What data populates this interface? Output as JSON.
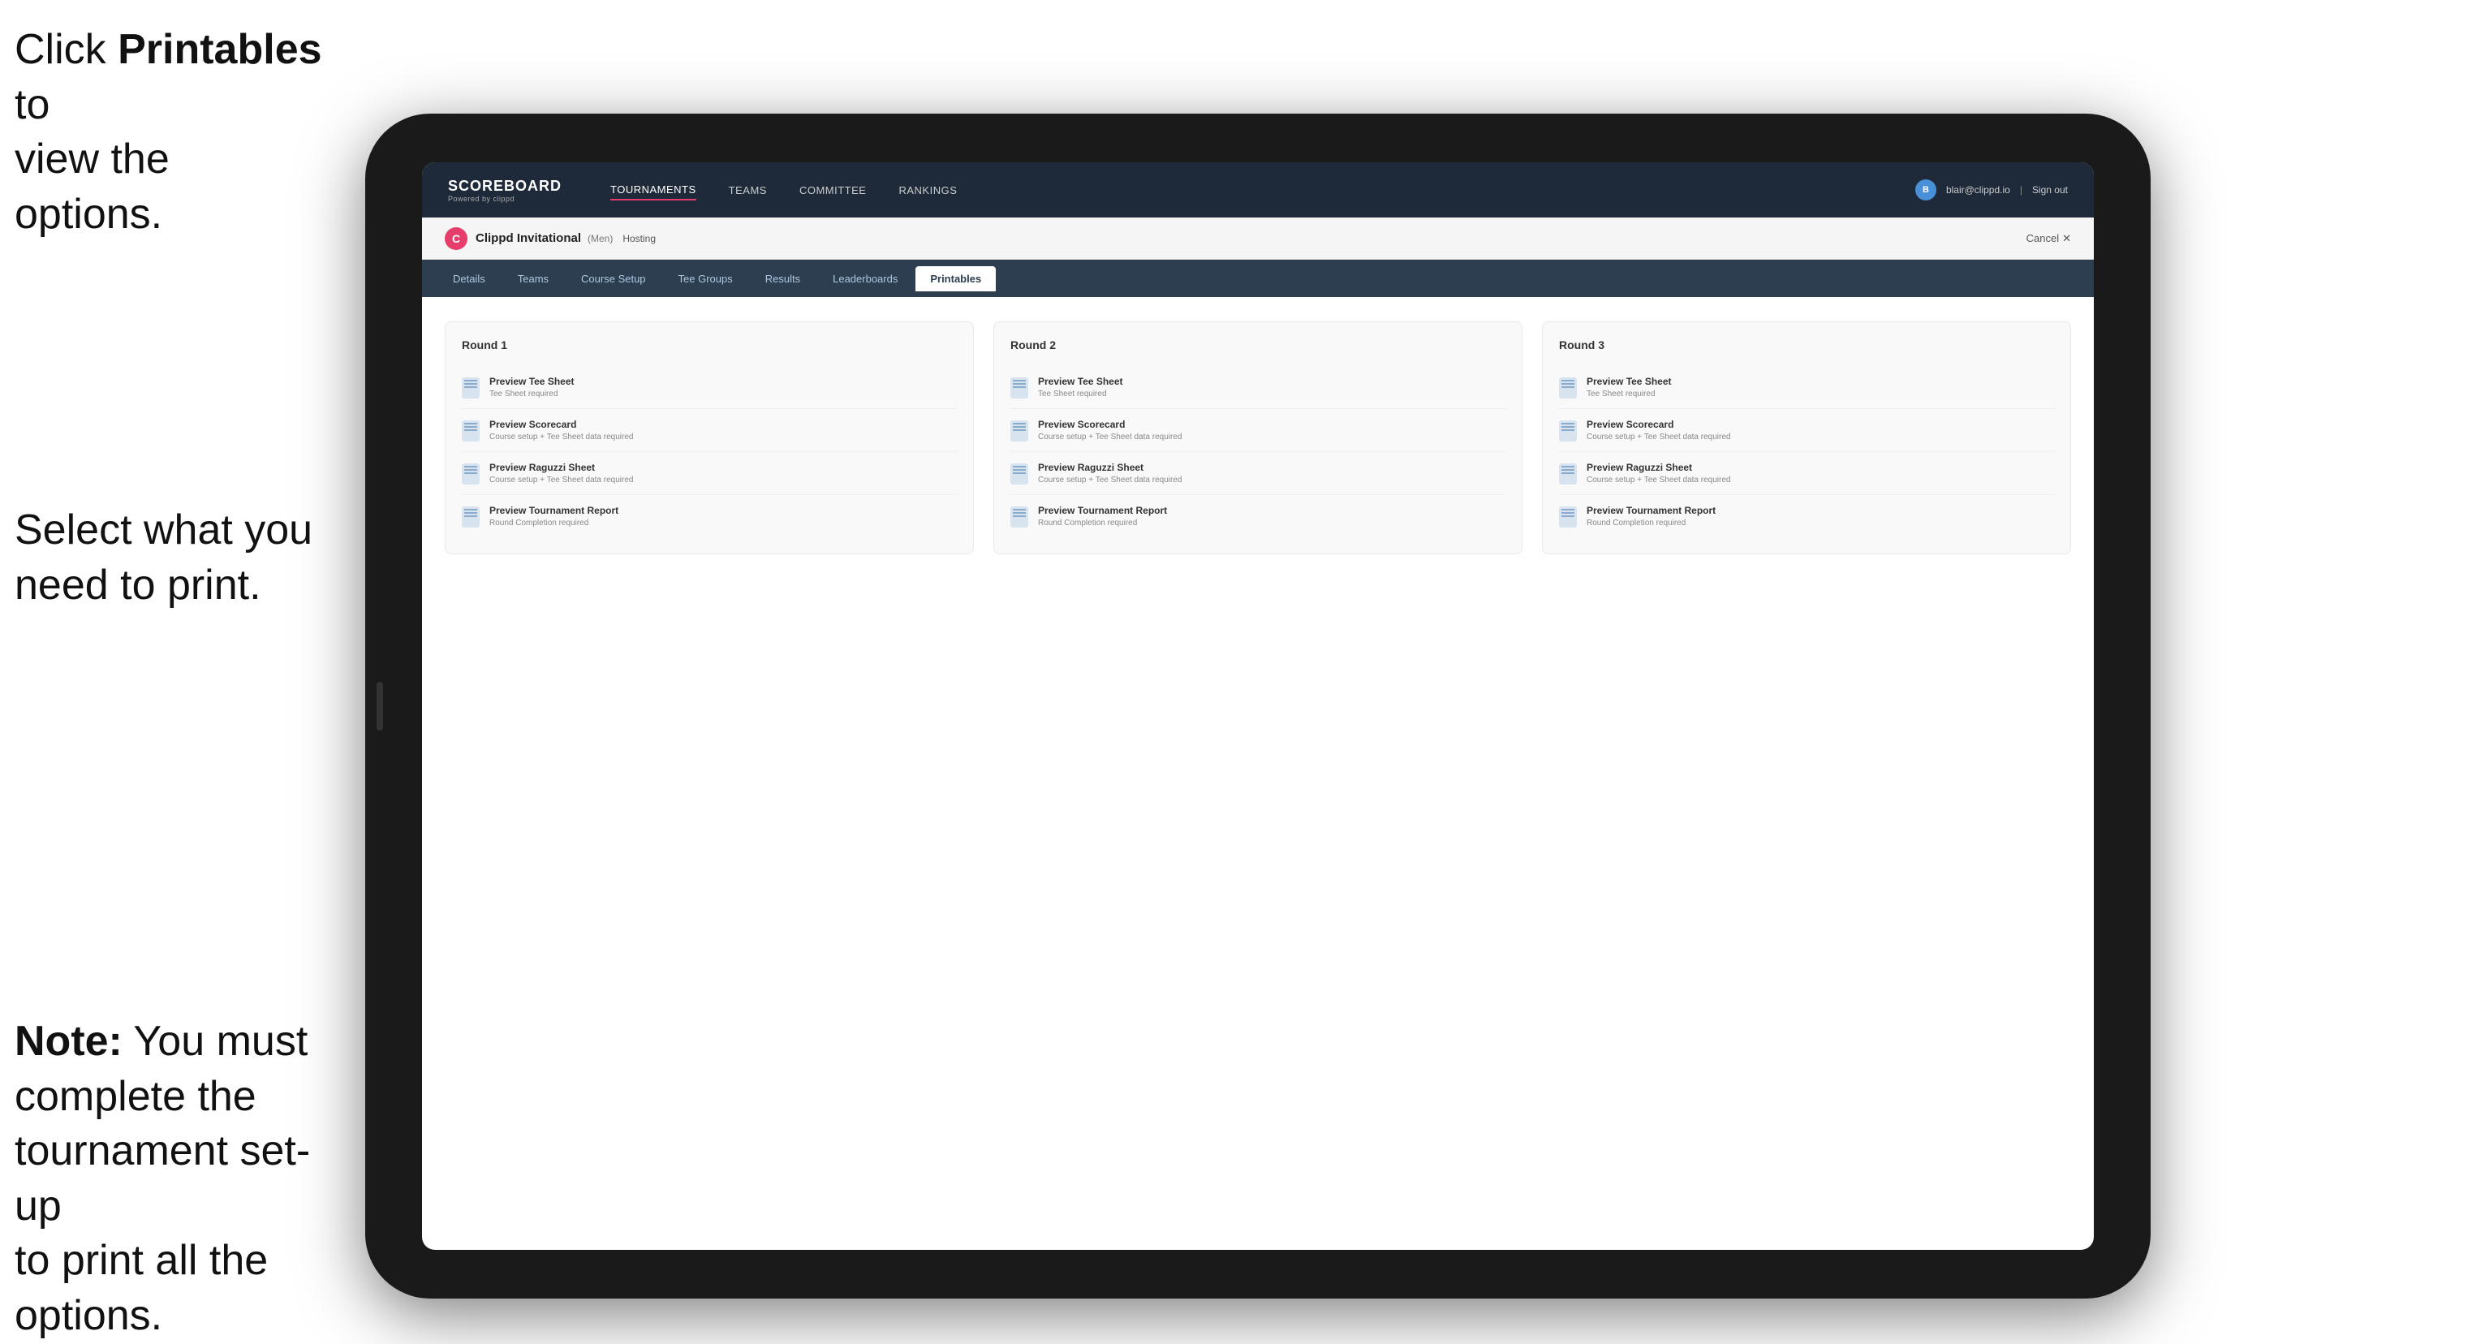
{
  "instructions": {
    "top_line1": "Click ",
    "top_bold": "Printables",
    "top_line2": " to",
    "top_line3": "view the options.",
    "middle_line1": "Select what you",
    "middle_line2": "need to print.",
    "bottom_bold": "Note:",
    "bottom_line1": " You must",
    "bottom_line2": "complete the",
    "bottom_line3": "tournament set-up",
    "bottom_line4": "to print all the options."
  },
  "header": {
    "logo_title": "SCOREBOARD",
    "logo_subtitle": "Powered by clippd",
    "nav": [
      {
        "label": "TOURNAMENTS",
        "active": true
      },
      {
        "label": "TEAMS",
        "active": false
      },
      {
        "label": "COMMITTEE",
        "active": false
      },
      {
        "label": "RANKINGS",
        "active": false
      }
    ],
    "user_email": "blair@clippd.io",
    "sign_out": "Sign out"
  },
  "tournament": {
    "name": "Clippd Invitational",
    "tag": "(Men)",
    "status": "Hosting",
    "cancel": "Cancel"
  },
  "tabs": [
    {
      "label": "Details",
      "active": false
    },
    {
      "label": "Teams",
      "active": false
    },
    {
      "label": "Course Setup",
      "active": false
    },
    {
      "label": "Tee Groups",
      "active": false
    },
    {
      "label": "Results",
      "active": false
    },
    {
      "label": "Leaderboards",
      "active": false
    },
    {
      "label": "Printables",
      "active": true
    }
  ],
  "rounds": [
    {
      "title": "Round 1",
      "items": [
        {
          "title": "Preview Tee Sheet",
          "subtitle": "Tee Sheet required"
        },
        {
          "title": "Preview Scorecard",
          "subtitle": "Course setup + Tee Sheet data required"
        },
        {
          "title": "Preview Raguzzi Sheet",
          "subtitle": "Course setup + Tee Sheet data required"
        },
        {
          "title": "Preview Tournament Report",
          "subtitle": "Round Completion required"
        }
      ]
    },
    {
      "title": "Round 2",
      "items": [
        {
          "title": "Preview Tee Sheet",
          "subtitle": "Tee Sheet required"
        },
        {
          "title": "Preview Scorecard",
          "subtitle": "Course setup + Tee Sheet data required"
        },
        {
          "title": "Preview Raguzzi Sheet",
          "subtitle": "Course setup + Tee Sheet data required"
        },
        {
          "title": "Preview Tournament Report",
          "subtitle": "Round Completion required"
        }
      ]
    },
    {
      "title": "Round 3",
      "items": [
        {
          "title": "Preview Tee Sheet",
          "subtitle": "Tee Sheet required"
        },
        {
          "title": "Preview Scorecard",
          "subtitle": "Course setup + Tee Sheet data required"
        },
        {
          "title": "Preview Raguzzi Sheet",
          "subtitle": "Course setup + Tee Sheet data required"
        },
        {
          "title": "Preview Tournament Report",
          "subtitle": "Round Completion required"
        }
      ]
    }
  ]
}
